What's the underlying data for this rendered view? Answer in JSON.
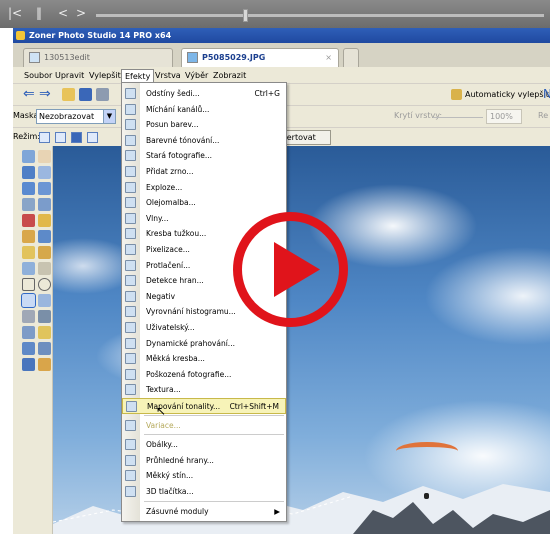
{
  "window": {
    "title": "Zoner Photo Studio 14 PRO x64"
  },
  "tabs": [
    {
      "label": "130513edit",
      "active": false
    },
    {
      "label": "P5085029.JPG",
      "active": true
    }
  ],
  "menubar": [
    "Soubor",
    "Upravit",
    "Vylepšit",
    "Efekty",
    "Vrstva",
    "Výběr",
    "Zobrazit"
  ],
  "toolbar": {
    "auto_improve": "Automaticky vylepšit"
  },
  "options": {
    "mask_label": "Maska:",
    "mask_value": "Nezobrazovat",
    "opacity_label": "Krytí vrstvy:",
    "opacity_value": "100%",
    "trailing_label": "Re"
  },
  "mode": {
    "label": "Režim:",
    "button": "vertovat"
  },
  "effects_menu": {
    "items": [
      {
        "label": "Odstíny šedi...",
        "shortcut": "Ctrl+G",
        "icon": "grayscale-icon"
      },
      {
        "label": "Míchání kanálů...",
        "shortcut": "",
        "icon": "channel-mixer-icon"
      },
      {
        "label": "Posun barev...",
        "shortcut": "",
        "icon": "color-shift-icon"
      },
      {
        "label": "Barevné tónování...",
        "shortcut": "",
        "icon": "color-toning-icon"
      },
      {
        "label": "Stará fotografie...",
        "shortcut": "",
        "icon": "old-photo-icon"
      },
      {
        "label": "Přidat zrno...",
        "shortcut": "",
        "icon": "grain-icon"
      },
      {
        "label": "Exploze...",
        "shortcut": "",
        "icon": "explosion-icon"
      },
      {
        "label": "Olejomalba...",
        "shortcut": "",
        "icon": "oil-paint-icon"
      },
      {
        "label": "Vlny...",
        "shortcut": "",
        "icon": "waves-icon"
      },
      {
        "label": "Kresba tužkou...",
        "shortcut": "",
        "icon": "pencil-sketch-icon"
      },
      {
        "label": "Pixelizace...",
        "shortcut": "",
        "icon": "pixelate-icon"
      },
      {
        "label": "Protlačení...",
        "shortcut": "",
        "icon": "emboss-icon"
      },
      {
        "label": "Detekce hran...",
        "shortcut": "",
        "icon": "edge-detect-icon"
      },
      {
        "label": "Negativ",
        "shortcut": "",
        "icon": "negative-icon"
      },
      {
        "label": "Vyrovnání histogramu...",
        "shortcut": "",
        "icon": "histogram-icon"
      },
      {
        "label": "Uživatelský...",
        "shortcut": "",
        "icon": "custom-filter-icon"
      },
      {
        "label": "Dynamické prahování...",
        "shortcut": "",
        "icon": "threshold-icon"
      },
      {
        "label": "Měkká kresba...",
        "shortcut": "",
        "icon": "soft-sketch-icon"
      },
      {
        "label": "Poškozená fotografie...",
        "shortcut": "",
        "icon": "damaged-photo-icon"
      },
      {
        "label": "Textura...",
        "shortcut": "",
        "icon": "texture-icon"
      },
      {
        "label": "Mapování tonality...",
        "shortcut": "Ctrl+Shift+M",
        "icon": "tone-mapping-icon",
        "highlighted": true
      },
      {
        "label": "Variace...",
        "shortcut": "",
        "icon": "variations-icon",
        "dimmed": true
      },
      {
        "label": "Obálky...",
        "shortcut": "",
        "icon": "envelope-icon"
      },
      {
        "label": "Průhledné hrany...",
        "shortcut": "",
        "icon": "transparent-edges-icon"
      },
      {
        "label": "Měkký stín...",
        "shortcut": "",
        "icon": "soft-shadow-icon"
      },
      {
        "label": "3D tlačítka...",
        "shortcut": "",
        "icon": "3d-buttons-icon"
      },
      {
        "label": "Zásuvné moduly",
        "shortcut": "▶",
        "icon": ""
      }
    ]
  },
  "colors": {
    "accent": "#2f5fb8",
    "play_overlay": "#e0141b",
    "highlight": "#f7f3b8"
  }
}
